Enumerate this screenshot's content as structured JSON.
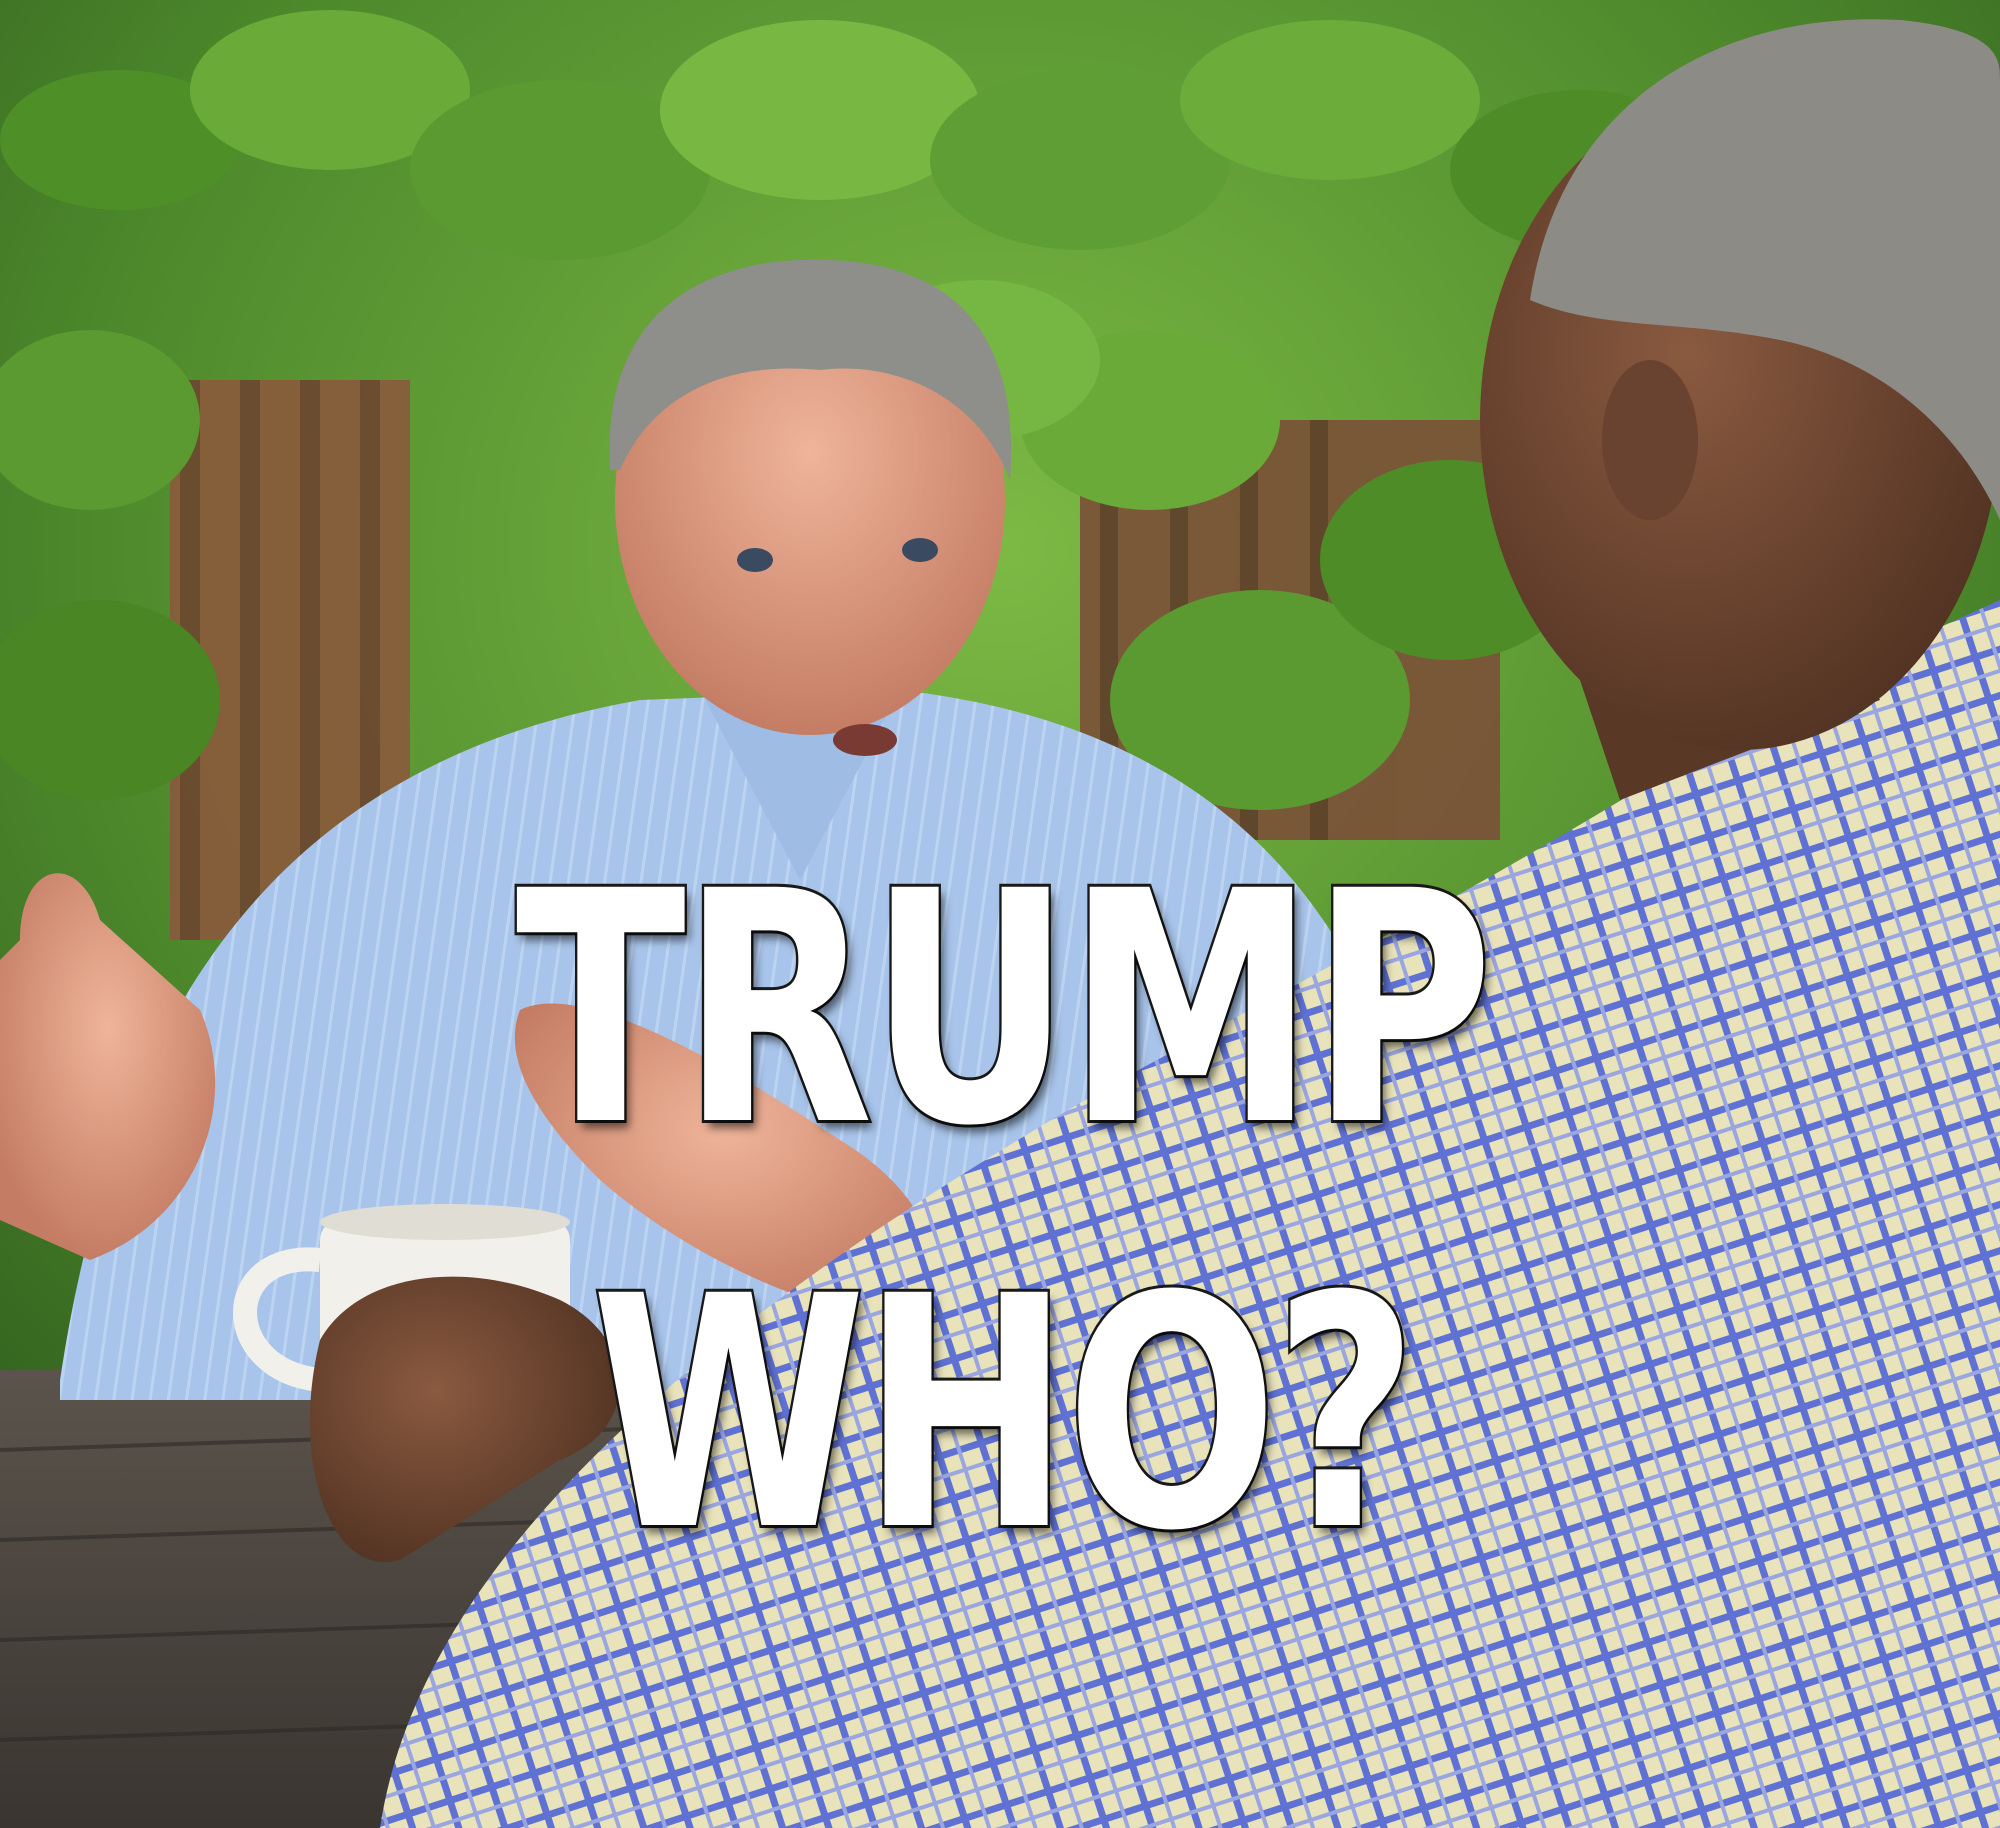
{
  "meme": {
    "line1": "TRUMP",
    "line2": "WHO?"
  },
  "colors": {
    "foliage_dark": "#2f5a1e",
    "foliage_light": "#6fae3a",
    "fence": "#8a5a3c",
    "shirt_blue": "#a9c6ea",
    "plaid_base": "#e8e2b8",
    "plaid_line": "#5b6fd0",
    "table": "#4a4540",
    "caption_fill": "#ffffff",
    "caption_outline": "#1a1a1a"
  }
}
